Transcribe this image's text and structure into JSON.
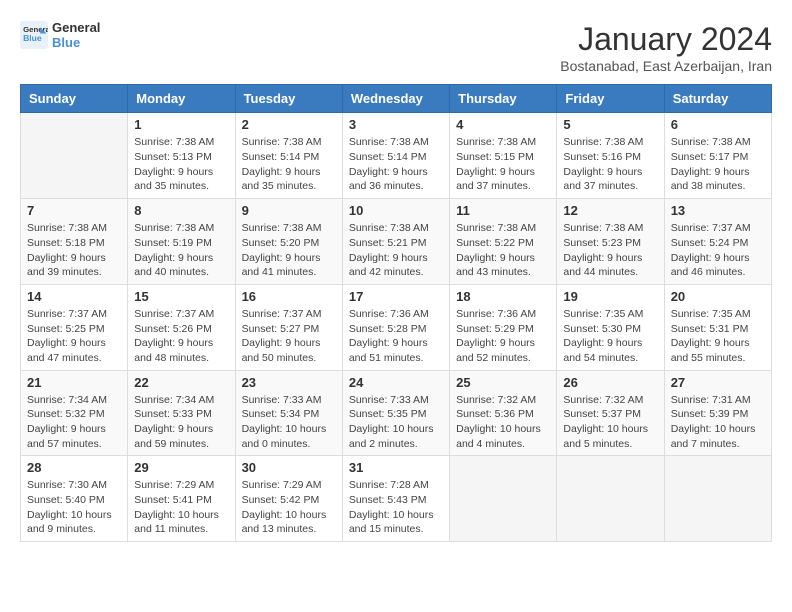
{
  "logo": {
    "line1": "General",
    "line2": "Blue"
  },
  "title": "January 2024",
  "subtitle": "Bostanabad, East Azerbaijan, Iran",
  "headers": [
    "Sunday",
    "Monday",
    "Tuesday",
    "Wednesday",
    "Thursday",
    "Friday",
    "Saturday"
  ],
  "weeks": [
    [
      {
        "day": "",
        "info": ""
      },
      {
        "day": "1",
        "info": "Sunrise: 7:38 AM\nSunset: 5:13 PM\nDaylight: 9 hours\nand 35 minutes."
      },
      {
        "day": "2",
        "info": "Sunrise: 7:38 AM\nSunset: 5:14 PM\nDaylight: 9 hours\nand 35 minutes."
      },
      {
        "day": "3",
        "info": "Sunrise: 7:38 AM\nSunset: 5:14 PM\nDaylight: 9 hours\nand 36 minutes."
      },
      {
        "day": "4",
        "info": "Sunrise: 7:38 AM\nSunset: 5:15 PM\nDaylight: 9 hours\nand 37 minutes."
      },
      {
        "day": "5",
        "info": "Sunrise: 7:38 AM\nSunset: 5:16 PM\nDaylight: 9 hours\nand 37 minutes."
      },
      {
        "day": "6",
        "info": "Sunrise: 7:38 AM\nSunset: 5:17 PM\nDaylight: 9 hours\nand 38 minutes."
      }
    ],
    [
      {
        "day": "7",
        "info": "Sunrise: 7:38 AM\nSunset: 5:18 PM\nDaylight: 9 hours\nand 39 minutes."
      },
      {
        "day": "8",
        "info": "Sunrise: 7:38 AM\nSunset: 5:19 PM\nDaylight: 9 hours\nand 40 minutes."
      },
      {
        "day": "9",
        "info": "Sunrise: 7:38 AM\nSunset: 5:20 PM\nDaylight: 9 hours\nand 41 minutes."
      },
      {
        "day": "10",
        "info": "Sunrise: 7:38 AM\nSunset: 5:21 PM\nDaylight: 9 hours\nand 42 minutes."
      },
      {
        "day": "11",
        "info": "Sunrise: 7:38 AM\nSunset: 5:22 PM\nDaylight: 9 hours\nand 43 minutes."
      },
      {
        "day": "12",
        "info": "Sunrise: 7:38 AM\nSunset: 5:23 PM\nDaylight: 9 hours\nand 44 minutes."
      },
      {
        "day": "13",
        "info": "Sunrise: 7:37 AM\nSunset: 5:24 PM\nDaylight: 9 hours\nand 46 minutes."
      }
    ],
    [
      {
        "day": "14",
        "info": "Sunrise: 7:37 AM\nSunset: 5:25 PM\nDaylight: 9 hours\nand 47 minutes."
      },
      {
        "day": "15",
        "info": "Sunrise: 7:37 AM\nSunset: 5:26 PM\nDaylight: 9 hours\nand 48 minutes."
      },
      {
        "day": "16",
        "info": "Sunrise: 7:37 AM\nSunset: 5:27 PM\nDaylight: 9 hours\nand 50 minutes."
      },
      {
        "day": "17",
        "info": "Sunrise: 7:36 AM\nSunset: 5:28 PM\nDaylight: 9 hours\nand 51 minutes."
      },
      {
        "day": "18",
        "info": "Sunrise: 7:36 AM\nSunset: 5:29 PM\nDaylight: 9 hours\nand 52 minutes."
      },
      {
        "day": "19",
        "info": "Sunrise: 7:35 AM\nSunset: 5:30 PM\nDaylight: 9 hours\nand 54 minutes."
      },
      {
        "day": "20",
        "info": "Sunrise: 7:35 AM\nSunset: 5:31 PM\nDaylight: 9 hours\nand 55 minutes."
      }
    ],
    [
      {
        "day": "21",
        "info": "Sunrise: 7:34 AM\nSunset: 5:32 PM\nDaylight: 9 hours\nand 57 minutes."
      },
      {
        "day": "22",
        "info": "Sunrise: 7:34 AM\nSunset: 5:33 PM\nDaylight: 9 hours\nand 59 minutes."
      },
      {
        "day": "23",
        "info": "Sunrise: 7:33 AM\nSunset: 5:34 PM\nDaylight: 10 hours\nand 0 minutes."
      },
      {
        "day": "24",
        "info": "Sunrise: 7:33 AM\nSunset: 5:35 PM\nDaylight: 10 hours\nand 2 minutes."
      },
      {
        "day": "25",
        "info": "Sunrise: 7:32 AM\nSunset: 5:36 PM\nDaylight: 10 hours\nand 4 minutes."
      },
      {
        "day": "26",
        "info": "Sunrise: 7:32 AM\nSunset: 5:37 PM\nDaylight: 10 hours\nand 5 minutes."
      },
      {
        "day": "27",
        "info": "Sunrise: 7:31 AM\nSunset: 5:39 PM\nDaylight: 10 hours\nand 7 minutes."
      }
    ],
    [
      {
        "day": "28",
        "info": "Sunrise: 7:30 AM\nSunset: 5:40 PM\nDaylight: 10 hours\nand 9 minutes."
      },
      {
        "day": "29",
        "info": "Sunrise: 7:29 AM\nSunset: 5:41 PM\nDaylight: 10 hours\nand 11 minutes."
      },
      {
        "day": "30",
        "info": "Sunrise: 7:29 AM\nSunset: 5:42 PM\nDaylight: 10 hours\nand 13 minutes."
      },
      {
        "day": "31",
        "info": "Sunrise: 7:28 AM\nSunset: 5:43 PM\nDaylight: 10 hours\nand 15 minutes."
      },
      {
        "day": "",
        "info": ""
      },
      {
        "day": "",
        "info": ""
      },
      {
        "day": "",
        "info": ""
      }
    ]
  ]
}
